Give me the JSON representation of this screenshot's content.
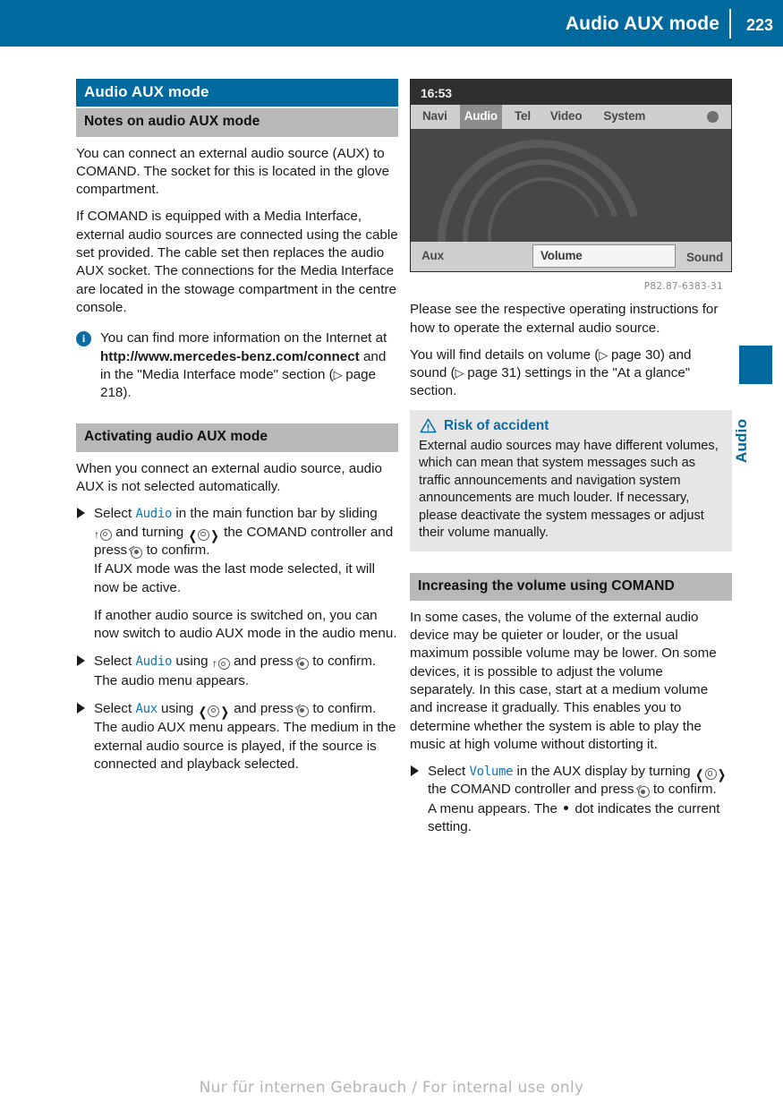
{
  "header": {
    "title": "Audio AUX mode",
    "page_number": "223"
  },
  "side_tab": {
    "label": "Audio",
    "color": "#00699e"
  },
  "footer": {
    "text": "Nur für internen Gebrauch / For internal use only"
  },
  "left_column": {
    "main_heading": "Audio AUX mode",
    "section1": {
      "heading": "Notes on audio AUX mode",
      "para1": "You can connect an external audio source (AUX) to COMAND. The socket for this is located in the glove compartment.",
      "para2": "If COMAND is equipped with a Media Interface, external audio sources are connected using the cable set provided. The cable set then replaces the audio AUX socket. The connections for the Media Interface are located in the stowage compartment in the centre console.",
      "note": {
        "icon": "info-icon",
        "text_before": "You can find more information on the Internet at ",
        "link_text": "http://www.mercedes-benz.com/connect",
        "text_after": " and in the \"Media Interface mode\" section (",
        "reference": "page 218",
        "text_end": ")."
      }
    },
    "section2": {
      "heading": "Activating audio AUX mode",
      "para1": "When you connect an external audio source, audio AUX is not selected automatically.",
      "step1": {
        "before_cmd": "Select ",
        "cmd": "Audio",
        "mid1": " in the main function bar by sliding ",
        "glyph1": "slide-up-knob",
        "mid2": " and turning ",
        "glyph2": "turn-knob",
        "mid3": " the COMAND controller and press ",
        "glyph3": "press-knob",
        "mid4": " to confirm.",
        "result1": "If AUX mode was the last mode selected, it will now be active.",
        "result2": "If another audio source is switched on, you can now switch to audio AUX mode in the audio menu."
      },
      "step2": {
        "before_cmd": "Select ",
        "cmd": "Audio",
        "mid1": " using ",
        "glyph1": "slide-up-knob",
        "mid2": " and press ",
        "glyph2": "press-knob",
        "mid3": " to confirm.",
        "result": "The audio menu appears."
      },
      "step3": {
        "before_cmd": "Select ",
        "cmd": "Aux",
        "mid1": " using ",
        "glyph1": "turn-knob",
        "mid2": " and press ",
        "glyph2": "press-knob",
        "mid3": " to confirm.",
        "result": "The audio AUX menu appears. The medium in the external audio source is played, if the source is connected and playback selected."
      }
    }
  },
  "right_column": {
    "figure": {
      "clock": "16:53",
      "menu_items": [
        "Navi",
        "Audio",
        "Tel",
        "Video",
        "System"
      ],
      "selected_menu": "Audio",
      "menu_icon": "circle-icon",
      "softkeys": [
        "Aux",
        "Volume",
        "Sound"
      ],
      "highlighted_softkey": "Volume",
      "caption": "P82.87-6383-31"
    },
    "para1": "Please see the respective operating instructions for how to operate the external audio source.",
    "para2_part1": "You will find details on volume (",
    "para2_ref1": "page 30",
    "para2_part2": ") and sound (",
    "para2_ref2": "page 31",
    "para2_part3": ") settings in the \"At a glance\" section.",
    "warning": {
      "icon": "warning-triangle-icon",
      "heading": "Risk of accident",
      "body": "External audio sources may have different volumes, which can mean that system messages such as traffic announcements and navigation system announcements are much louder. If necessary, please deactivate the system messages or adjust their volume manually.",
      "heading_color": "#0d6ca4"
    },
    "section": {
      "heading": "Increasing the volume using COMAND",
      "para1": "In some cases, the volume of the external audio device may be quieter or louder, or the usual maximum possible volume may be lower. On some devices, it is possible to adjust the volume separately. In this case, start at a medium volume and increase it gradually. This enables you to determine whether the system is able to play the music at high volume without distorting it.",
      "step1": {
        "before_cmd": "Select ",
        "cmd": "Volume",
        "mid1": " in the AUX display by turning ",
        "glyph1": "turn-knob",
        "mid2": " the COMAND controller and press ",
        "glyph2": "press-knob",
        "mid3": " to confirm.",
        "result_part1": "A menu appears. The ",
        "result_dot": "bullet-dot",
        "result_part2": " dot indicates the current setting."
      }
    }
  }
}
